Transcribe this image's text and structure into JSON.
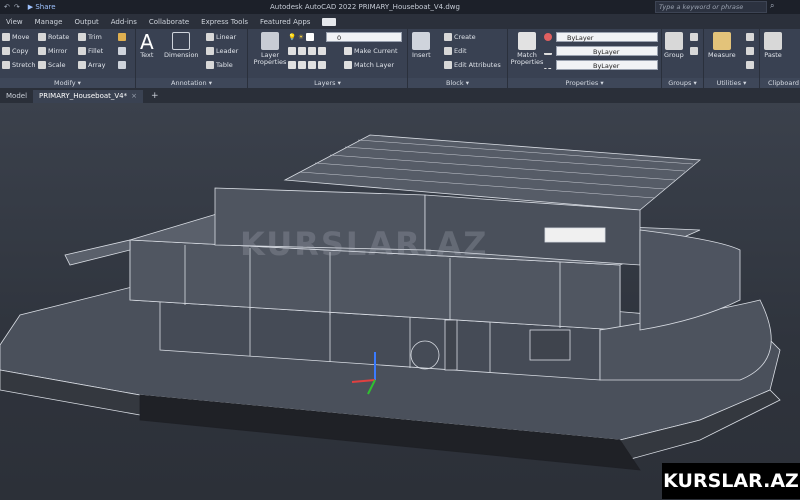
{
  "titlebar": {
    "share_label": "Share",
    "title": "Autodesk AutoCAD 2022   PRIMARY_Houseboat_V4.dwg",
    "search_placeholder": "Type a keyword or phrase"
  },
  "menu": [
    "View",
    "Manage",
    "Output",
    "Add-ins",
    "Collaborate",
    "Express Tools",
    "Featured Apps"
  ],
  "ribbon": {
    "modify": {
      "title": "Modify",
      "move": "Move",
      "rotate": "Rotate",
      "trim": "Trim",
      "copy": "Copy",
      "mirror": "Mirror",
      "fillet": "Fillet",
      "stretch": "Stretch",
      "scale": "Scale",
      "array": "Array"
    },
    "annotation": {
      "title": "Annotation",
      "text": "Text",
      "dimension": "Dimension",
      "linear": "Linear",
      "leader": "Leader",
      "table": "Table"
    },
    "layers": {
      "title": "Layers",
      "layer_properties": "Layer Properties",
      "current_layer": "0",
      "make_current": "Make Current",
      "match_layer": "Match Layer"
    },
    "block": {
      "title": "Block",
      "insert": "Insert",
      "create": "Create",
      "edit": "Edit",
      "edit_attributes": "Edit Attributes"
    },
    "properties": {
      "title": "Properties",
      "match_properties": "Match Properties",
      "color": "ByLayer",
      "linetype": "ByLayer",
      "lineweight": "ByLayer"
    },
    "groups": {
      "title": "Groups",
      "group": "Group"
    },
    "utilities": {
      "title": "Utilities",
      "measure": "Measure"
    },
    "clipboard": {
      "title": "Clipboard",
      "paste": "Paste"
    }
  },
  "tabs": [
    {
      "label": "Model"
    },
    {
      "label": "PRIMARY_Houseboat_V4*"
    }
  ],
  "watermark": "KURSLAR.AZ",
  "brand": "KURSLAR.AZ",
  "colors": {
    "accent": "#4a90e2",
    "viewport": "#3b414c",
    "ribbon": "#394152"
  }
}
